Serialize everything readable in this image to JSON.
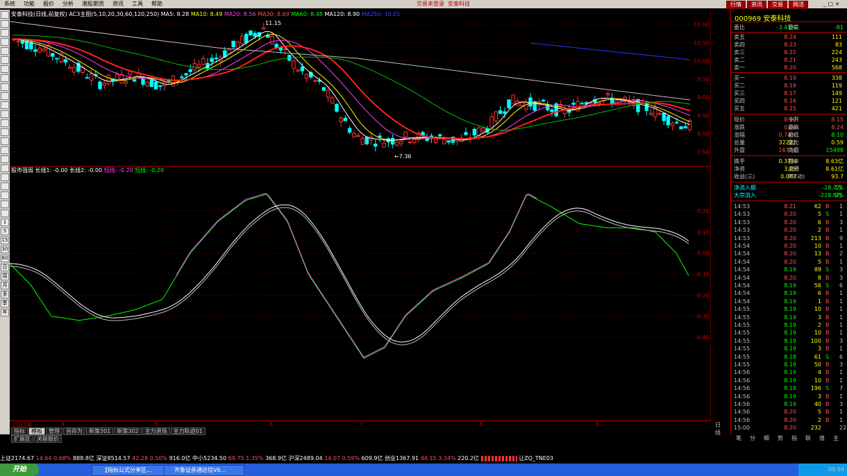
{
  "menu": {
    "items": [
      "系统",
      "功能",
      "报价",
      "分析",
      "港股期货",
      "资讯",
      "工具",
      "帮助"
    ],
    "center": [
      "交易未登录",
      "安泰科技"
    ],
    "buttons": [
      "行情",
      "资讯",
      "交易",
      "网活"
    ]
  },
  "window_controls": [
    "_",
    "□",
    "×"
  ],
  "left_toolbar": [
    "",
    "",
    "",
    "",
    "",
    "",
    "",
    "",
    "",
    "",
    "",
    "",
    "",
    "",
    "",
    "",
    "",
    "",
    "",
    "",
    "",
    "",
    "",
    "1",
    "5",
    "15",
    "30",
    "60",
    "日",
    "周",
    "月",
    "多",
    "季",
    "年"
  ],
  "kline_header": {
    "title": "安泰科技(日线,前复权)",
    "params": "AC3主图(5,10,20,30,60,120,250)",
    "ma5": "MA5: 8.28",
    "ma10": "MA10: 8.49",
    "ma20": "MA20: 8.56",
    "ma30": "MA30: 8.69",
    "ma60": "MA60: 8.48",
    "ma120": "MA120: 8.90",
    "ma250": "MA250: 10.01",
    "high_label": "11.15",
    "low_label": "←7.36"
  },
  "price_axis": [
    "11.00",
    "10.50",
    "10.00",
    "9.50",
    "9.00",
    "8.50",
    "8.00",
    "7.50"
  ],
  "ind_header": {
    "name": "股市强弱",
    "l1": "长线1: -0.00",
    "l2": "长线2: -0.00",
    "l3": "短线: -0.20",
    "l4": "短线: -0.20"
  },
  "ind_axis": [
    "0.20",
    "0.10",
    "0.00",
    "-0.10",
    "-0.20",
    "-0.30",
    "-0.40"
  ],
  "dates": [
    "2013年",
    "4",
    "5",
    "6",
    "7",
    "8",
    "9"
  ],
  "period_label": "日线",
  "tabs1": [
    "指标",
    "模板",
    "管理",
    "另存为",
    "新策301",
    "新策302",
    "主力进场",
    "主力轨迹01"
  ],
  "tabs2": [
    "扩展区",
    "关联报价"
  ],
  "quote": {
    "code_name": "000969 安泰科技",
    "wb_label": "委比",
    "wb_val": "-3.41%",
    "wc_label": "委差",
    "wc_val": "-81",
    "asks": [
      {
        "l": "卖五",
        "p": "8.24",
        "q": "111"
      },
      {
        "l": "卖四",
        "p": "8.23",
        "q": "83"
      },
      {
        "l": "卖三",
        "p": "8.22",
        "q": "224"
      },
      {
        "l": "卖二",
        "p": "8.21",
        "q": "243"
      },
      {
        "l": "卖一",
        "p": "8.20",
        "q": "568"
      }
    ],
    "bids": [
      {
        "l": "买一",
        "p": "8.19",
        "q": "338"
      },
      {
        "l": "买二",
        "p": "8.18",
        "q": "119"
      },
      {
        "l": "买三",
        "p": "8.17",
        "q": "149"
      },
      {
        "l": "买四",
        "p": "8.16",
        "q": "121"
      },
      {
        "l": "买五",
        "p": "8.15",
        "q": "421"
      }
    ],
    "stats": [
      {
        "l": "现价",
        "v": "8.20",
        "l2": "今开",
        "v2": "8.15"
      },
      {
        "l": "涨跌",
        "v": "0.06",
        "l2": "最高",
        "v2": "8.24"
      },
      {
        "l": "涨幅",
        "v": "0.74%",
        "l2": "最低",
        "v2": "8.10"
      },
      {
        "l": "总量",
        "v": "32222",
        "l2": "量比",
        "v2": "0.59"
      },
      {
        "l": "外盘",
        "v": "16724",
        "l2": "内盘",
        "v2": "15498"
      }
    ],
    "stats2": [
      {
        "l": "换手",
        "v": "0.37%",
        "l2": "股本",
        "v2": "8.63亿"
      },
      {
        "l": "净资",
        "v": "3.05",
        "l2": "流通",
        "v2": "8.61亿"
      },
      {
        "l": "收益(三)",
        "v": "0.087",
        "l2": "PE(动)",
        "v2": "93.7"
      }
    ],
    "flow": [
      {
        "l": "净流入额",
        "v": "-28.7万",
        "p": "-1%"
      },
      {
        "l": "大宗流入",
        "v": "-228.5万",
        "p": "-9%"
      }
    ]
  },
  "ticks": [
    {
      "t": "14:53",
      "p": "8.21",
      "q": "62",
      "d": "B",
      "e": "1"
    },
    {
      "t": "14:53",
      "p": "8.20",
      "q": "5",
      "d": "S",
      "e": "1"
    },
    {
      "t": "14:53",
      "p": "8.20",
      "q": "6",
      "d": "B",
      "e": "3"
    },
    {
      "t": "14:53",
      "p": "8.20",
      "q": "2",
      "d": "B",
      "e": "1"
    },
    {
      "t": "14:53",
      "p": "8.20",
      "q": "213",
      "d": "B",
      "e": "9"
    },
    {
      "t": "14:54",
      "p": "8.20",
      "q": "10",
      "d": "B",
      "e": "1"
    },
    {
      "t": "14:54",
      "p": "8.20",
      "q": "13",
      "d": "B",
      "e": "2"
    },
    {
      "t": "14:54",
      "p": "8.20",
      "q": "5",
      "d": "B",
      "e": "1"
    },
    {
      "t": "14:54",
      "p": "8.19",
      "q": "89",
      "d": "S",
      "e": "3"
    },
    {
      "t": "14:54",
      "p": "8.20",
      "q": "8",
      "d": "B",
      "e": "3"
    },
    {
      "t": "14:54",
      "p": "8.19",
      "q": "56",
      "d": "S",
      "e": "6"
    },
    {
      "t": "14:54",
      "p": "8.19",
      "q": "6",
      "d": "B",
      "e": "1"
    },
    {
      "t": "14:54",
      "p": "8.19",
      "q": "1",
      "d": "B",
      "e": "1"
    },
    {
      "t": "14:55",
      "p": "8.19",
      "q": "10",
      "d": "B",
      "e": "1"
    },
    {
      "t": "14:55",
      "p": "8.19",
      "q": "3",
      "d": "B",
      "e": "1"
    },
    {
      "t": "14:55",
      "p": "8.19",
      "q": "2",
      "d": "B",
      "e": "1"
    },
    {
      "t": "14:55",
      "p": "8.19",
      "q": "10",
      "d": "B",
      "e": "1"
    },
    {
      "t": "14:55",
      "p": "8.19",
      "q": "100",
      "d": "B",
      "e": "3"
    },
    {
      "t": "14:55",
      "p": "8.19",
      "q": "3",
      "d": "B",
      "e": "1"
    },
    {
      "t": "14:55",
      "p": "8.18",
      "q": "61",
      "d": "S",
      "e": "6"
    },
    {
      "t": "14:55",
      "p": "8.19",
      "q": "50",
      "d": "B",
      "e": "3"
    },
    {
      "t": "14:56",
      "p": "8.19",
      "q": "4",
      "d": "B",
      "e": "1"
    },
    {
      "t": "14:56",
      "p": "8.19",
      "q": "10",
      "d": "B",
      "e": "1"
    },
    {
      "t": "14:56",
      "p": "8.18",
      "q": "196",
      "d": "S",
      "e": "7"
    },
    {
      "t": "14:56",
      "p": "8.19",
      "q": "3",
      "d": "B",
      "e": "1"
    },
    {
      "t": "14:56",
      "p": "8.19",
      "q": "40",
      "d": "B",
      "e": "3"
    },
    {
      "t": "14:56",
      "p": "8.20",
      "q": "5",
      "d": "B",
      "e": "1"
    },
    {
      "t": "14:56",
      "p": "8.20",
      "q": "2",
      "d": "B",
      "e": "1"
    },
    {
      "t": "15:00",
      "p": "8.20",
      "q": "232",
      "d": "",
      "e": "22"
    }
  ],
  "rp_tabs": [
    "笔",
    "分",
    "细",
    "势",
    "指",
    "联",
    "值",
    "主"
  ],
  "status": {
    "sh": "上证2174.67",
    "sh_ch": "14.64",
    "sh_pct": "0.68%",
    "sh_amt": "888.8亿",
    "sz": "深证8514.57",
    "sz_ch": "42.28",
    "sz_pct": "0.50%",
    "sz_amt": "916.0亿",
    "zx": "中小5234.50",
    "zx_ch": "69.75",
    "zx_pct": "1.35%",
    "zx_amt": "368.9亿",
    "hs": "沪深2489.04",
    "hs_ch": "14.07",
    "hs_pct": "0.59%",
    "hs_amt": "609.9亿",
    "cy": "创业1367.91",
    "cy_ch": "44.15",
    "cy_pct": "3.34%",
    "cy_amt": "220.2亿",
    "tail": "让ZQ_TNE03"
  },
  "taskbar": {
    "start": "开始",
    "tasks": [
      "【指标公式分享区...",
      "齐鲁证券通达信V6..."
    ],
    "clock": "09:59"
  }
}
